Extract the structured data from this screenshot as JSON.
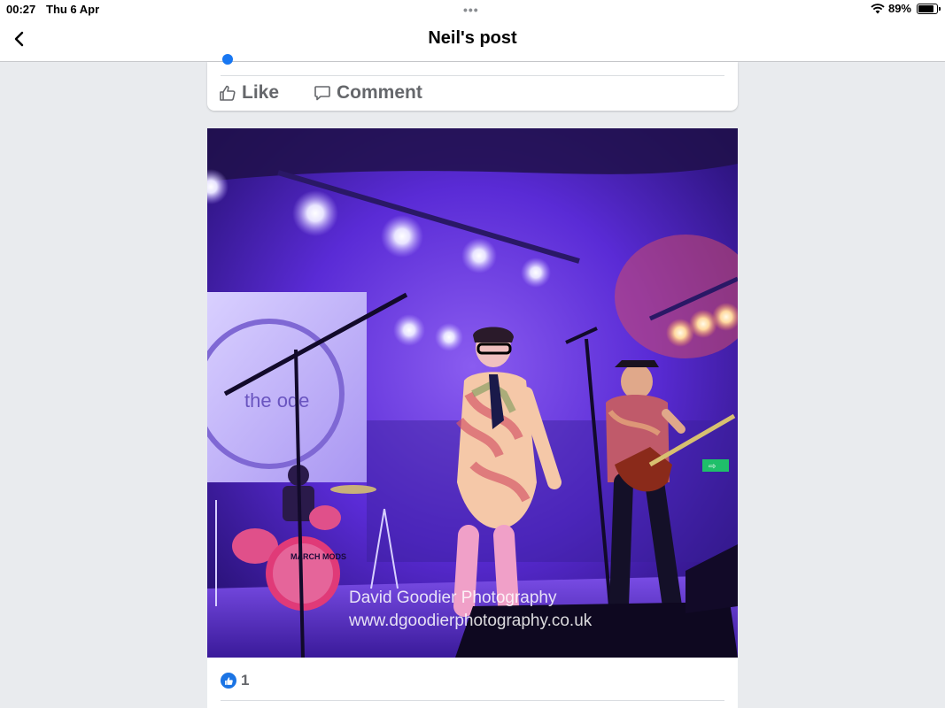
{
  "status_bar": {
    "time": "00:27",
    "date": "Thu 6 Apr",
    "dots": "•••",
    "battery": "89%"
  },
  "nav": {
    "title": "Neil's post"
  },
  "post_actions": {
    "like_label": "Like",
    "comment_label": "Comment"
  },
  "photo": {
    "screen_text": "the ode",
    "drum_text": "MARCH MODS",
    "exit_sign": "⇨",
    "watermark_line1": "David Goodier Photography",
    "watermark_line2": "www.dgoodierphotography.co.uk"
  },
  "reactions": {
    "count": "1"
  },
  "colors": {
    "accent": "#1877f2",
    "stage_purple": "#5a2bd6",
    "background": "#e9ebee"
  }
}
